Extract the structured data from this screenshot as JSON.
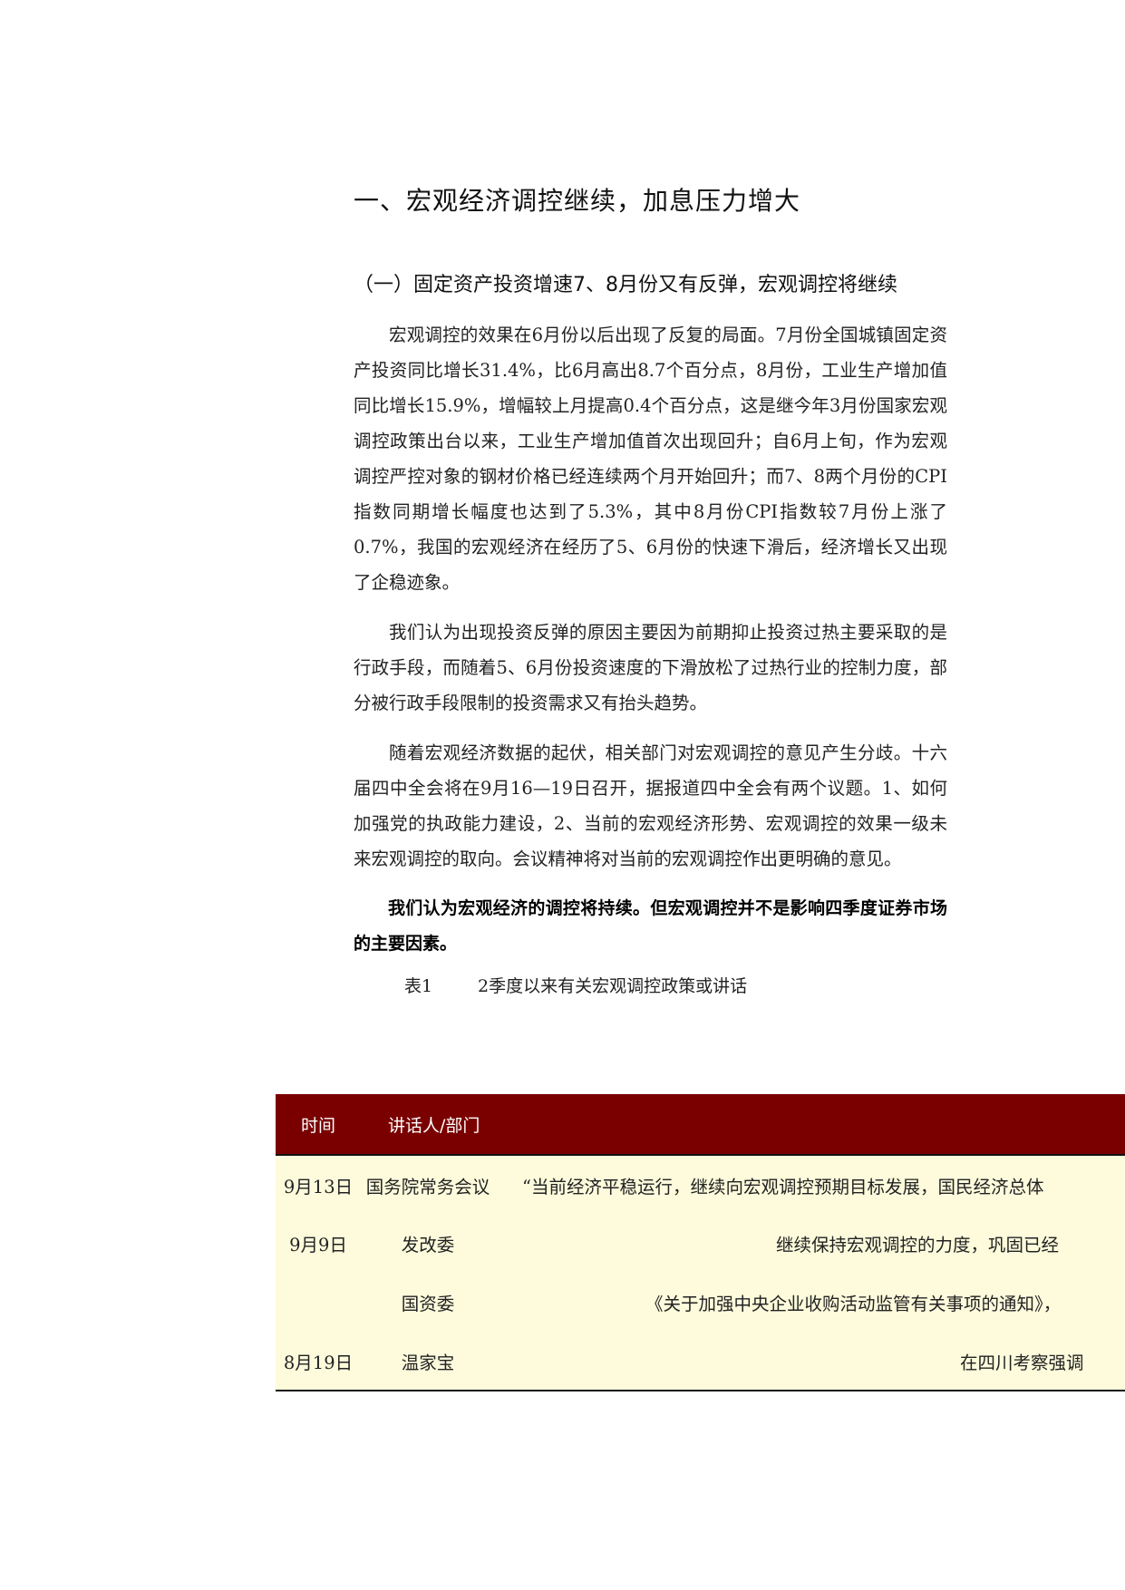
{
  "section_title": "一、宏观经济调控继续，加息压力增大",
  "subsection_title": "（一）固定资产投资增速7、8月份又有反弹，宏观调控将继续",
  "paragraphs": [
    "宏观调控的效果在6月份以后出现了反复的局面。7月份全国城镇固定资产投资同比增长31.4%，比6月高出8.7个百分点，8月份，工业生产增加值同比增长15.9%，增幅较上月提高0.4个百分点，这是继今年3月份国家宏观调控政策出台以来，工业生产增加值首次出现回升；自6月上旬，作为宏观调控严控对象的钢材价格已经连续两个月开始回升；而7、8两个月份的CPI指数同期增长幅度也达到了5.3%，其中8月份CPI指数较7月份上涨了0.7%，我国的宏观经济在经历了5、6月份的快速下滑后，经济增长又出现了企稳迹象。",
    "我们认为出现投资反弹的原因主要因为前期抑止投资过热主要采取的是行政手段，而随着5、6月份投资速度的下滑放松了过热行业的控制力度，部分被行政手段限制的投资需求又有抬头趋势。",
    "随着宏观经济数据的起伏，相关部门对宏观调控的意见产生分歧。十六届四中全会将在9月16—19日召开，据报道四中全会有两个议题。1、如何加强党的执政能力建设，2、当前的宏观经济形势、宏观调控的效果一级未来宏观调控的取向。会议精神将对当前的宏观调控作出更明确的意见。"
  ],
  "bold_paragraph": "我们认为宏观经济的调控将持续。但宏观调控并不是影响四季度证券市场的主要因素。",
  "table": {
    "caption_num": "表1",
    "caption_text": "2季度以来有关宏观调控政策或讲话",
    "headers": {
      "time": "时间",
      "speaker": "讲话人/部门"
    },
    "rows": [
      {
        "time": "9月13日",
        "speaker": "国务院常务会议",
        "content": "“当前经济平稳运行，继续向宏观调控预期目标发展，国民经济总体"
      },
      {
        "time": "9月9日",
        "speaker": "发改委",
        "content": "继续保持宏观调控的力度，巩固已经"
      },
      {
        "time": "",
        "speaker": "国资委",
        "content": "《关于加强中央企业收购活动监管有关事项的通知》，"
      },
      {
        "time": "8月19日",
        "speaker": "温家宝",
        "content": "在四川考察强调"
      }
    ]
  },
  "colors": {
    "table_header_bg": "#7a0000",
    "table_row_bg": "#fdfbdc"
  }
}
